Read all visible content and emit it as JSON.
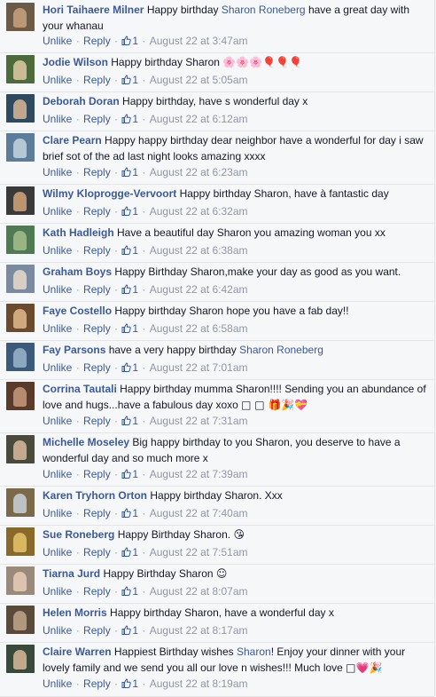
{
  "labels": {
    "unlike": "Unlike",
    "reply": "Reply",
    "like_count": "1"
  },
  "colors": {
    "link": "#3b5998",
    "meta": "#9197a3",
    "text": "#141823",
    "background": "#f6f7f9"
  },
  "comments": [
    {
      "name": "Hori Taihaere Milner",
      "parts": [
        [
          "t",
          " Happy birthday "
        ],
        [
          "m",
          "Sharon Roneberg"
        ],
        [
          "t",
          " have a great day with your whanau"
        ]
      ],
      "time": "August 22 at 3:47am"
    },
    {
      "name": "Jodie Wilson",
      "parts": [
        [
          "t",
          " Happy birthday Sharon "
        ],
        [
          "e",
          "🌸🌸🌸🎈🎈🎈"
        ]
      ],
      "time": "August 22 at 5:05am"
    },
    {
      "name": "Deborah Doran",
      "parts": [
        [
          "t",
          " Happy birthday, have s wonderful day x"
        ]
      ],
      "time": "August 22 at 6:12am"
    },
    {
      "name": "Clare Pearn",
      "parts": [
        [
          "t",
          " Happy happy birthday dear neighbor have a wonderful for day i saw brief sot of the ad last night looks amazing xxxx"
        ]
      ],
      "time": "August 22 at 6:23am"
    },
    {
      "name": "Wilmy Kloprogge-Vervoort",
      "parts": [
        [
          "t",
          " Happy birthday Sharon, have à fantastic day"
        ]
      ],
      "time": "August 22 at 6:32am"
    },
    {
      "name": "Kath Hadleigh",
      "parts": [
        [
          "t",
          " Have a beautiful day Sharon you amazing woman you xx"
        ]
      ],
      "time": "August 22 at 6:38am"
    },
    {
      "name": "Graham Boys",
      "parts": [
        [
          "t",
          " Happy Birthday Sharon,make your day as good as you want."
        ]
      ],
      "time": "August 22 at 6:42am"
    },
    {
      "name": "Faye Costello",
      "parts": [
        [
          "t",
          " Happy birthday Sharon hope you have a fab day!!"
        ]
      ],
      "time": "August 22 at 6:58am"
    },
    {
      "name": "Fay Parsons",
      "parts": [
        [
          "t",
          " have a very happy birthday "
        ],
        [
          "m",
          "Sharon Roneberg"
        ]
      ],
      "time": "August 22 at 7:01am"
    },
    {
      "name": "Corrina Tautali",
      "parts": [
        [
          "t",
          " Happy birthday mumma Sharon!!!! Sending you an abundance of love and hugs...have a fabulous day xoxo "
        ],
        [
          "e",
          "□ □ 🎁🎉💝"
        ]
      ],
      "time": "August 22 at 7:31am"
    },
    {
      "name": "Michelle Moseley",
      "parts": [
        [
          "t",
          " Big happy birthday to you Sharon, you deserve to have a wonderful day and so much more x"
        ]
      ],
      "time": "August 22 at 7:39am"
    },
    {
      "name": "Karen Tryhorn Orton",
      "parts": [
        [
          "t",
          " Happy birthday Sharon. Xxx"
        ]
      ],
      "time": "August 22 at 7:40am"
    },
    {
      "name": "Sue Roneberg",
      "parts": [
        [
          "t",
          " Happy Birthday Sharon. "
        ],
        [
          "e",
          "😘"
        ]
      ],
      "time": "August 22 at 7:51am"
    },
    {
      "name": "Tiarna Jurd",
      "parts": [
        [
          "t",
          " Happy Birthday Sharon "
        ],
        [
          "e",
          "☺"
        ]
      ],
      "time": "August 22 at 8:07am"
    },
    {
      "name": "Helen Morris",
      "parts": [
        [
          "t",
          " Happy birthday Sharon, have a wonderful day x"
        ]
      ],
      "time": "August 22 at 8:17am"
    },
    {
      "name": "Claire Warren",
      "parts": [
        [
          "t",
          " Happiest Birthday wishes "
        ],
        [
          "m",
          "Sharon"
        ],
        [
          "t",
          "! Enjoy your dinner with your lovely family and we send you all our love n wishes!!! Much love "
        ],
        [
          "e",
          "□💗🎉"
        ]
      ],
      "time": "August 22 at 8:19am"
    }
  ]
}
